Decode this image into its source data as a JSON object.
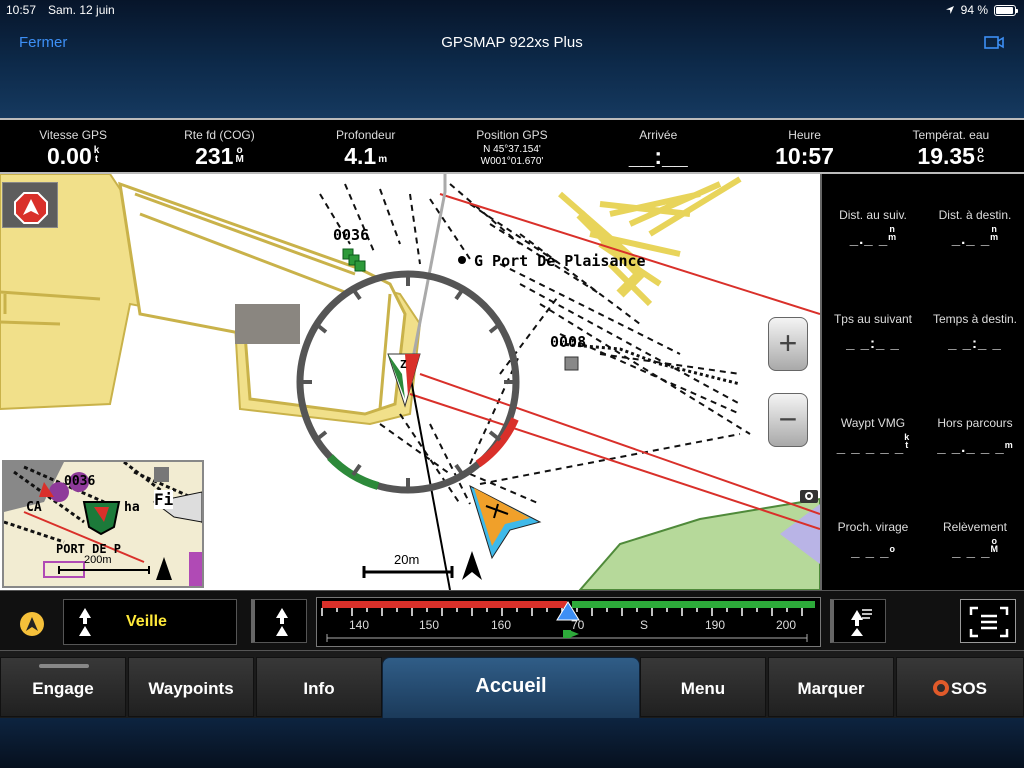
{
  "status_bar": {
    "time": "10:57",
    "date": "Sam. 12 juin",
    "battery": "94 %"
  },
  "header": {
    "close_label": "Fermer",
    "title": "GPSMAP 922xs Plus"
  },
  "data_fields": [
    {
      "label": "Vitesse GPS",
      "value": "0.00",
      "unit_top": "k",
      "unit_bottom": "t"
    },
    {
      "label": "Rte fd (COG)",
      "value": "231",
      "unit_top": "o",
      "unit_bottom": "M"
    },
    {
      "label": "Profondeur",
      "value": "4.1",
      "unit_top": "",
      "unit_bottom": "m"
    },
    {
      "label": "Position GPS",
      "lat": "N  45°37.154'",
      "lon": "W001°01.670'"
    },
    {
      "label": "Arrivée",
      "value": "__:__"
    },
    {
      "label": "Heure",
      "value": "10:57"
    },
    {
      "label": "Températ. eau",
      "value": "19.35",
      "unit_top": "o",
      "unit_bottom": "C"
    }
  ],
  "map": {
    "label_0036": "0036",
    "label_port": "G Port De Plaisance",
    "label_0008": "0008",
    "boat_label": "Z",
    "scale_label": "20m",
    "zoom_in": "+",
    "zoom_out": "−"
  },
  "inset": {
    "label_0036": "0036",
    "label_port": "PORT DE P",
    "label_scale": "200m",
    "label_fi": "Fi",
    "label_ca": "CA",
    "label_ha": "ha"
  },
  "side_panel": [
    {
      "label": "Dist. au suiv.",
      "value": "_._ _",
      "unit_top": "n",
      "unit_bottom": "m"
    },
    {
      "label": "Dist. à destin.",
      "value": "_._ _",
      "unit_top": "n",
      "unit_bottom": "m"
    },
    {
      "label": "Tps au suivant",
      "value": "_ _:_ _",
      "unit_top": "",
      "unit_bottom": ""
    },
    {
      "label": "Temps à destin.",
      "value": "_ _:_ _",
      "unit_top": "",
      "unit_bottom": ""
    },
    {
      "label": "Waypt VMG",
      "value": "_ _ _ _ _",
      "unit_top": "k",
      "unit_bottom": "t"
    },
    {
      "label": "Hors parcours",
      "value": "_ _._ _ _",
      "unit_top": "",
      "unit_bottom": "m"
    },
    {
      "label": "Proch. virage",
      "value": "_ _ _",
      "unit_top": "o",
      "unit_bottom": ""
    },
    {
      "label": "Relèvement",
      "value": "_ _ _",
      "unit_top": "o",
      "unit_bottom": "M"
    }
  ],
  "course_bar": {
    "mode": "Veille",
    "tape_labels": [
      "140",
      "150",
      "160",
      "70",
      "S",
      "190",
      "200"
    ]
  },
  "bottom_nav": {
    "engage": "Engage",
    "waypoints": "Waypoints",
    "info": "Info",
    "accueil": "Accueil",
    "menu": "Menu",
    "marquer": "Marquer",
    "sos": "SOS"
  },
  "colors": {
    "accent_blue": "#3d8ff5",
    "mode_yellow": "#ffe93a",
    "land": "#f1e08a",
    "route_red": "#d9302a",
    "sos_orange": "#e05a2a"
  }
}
